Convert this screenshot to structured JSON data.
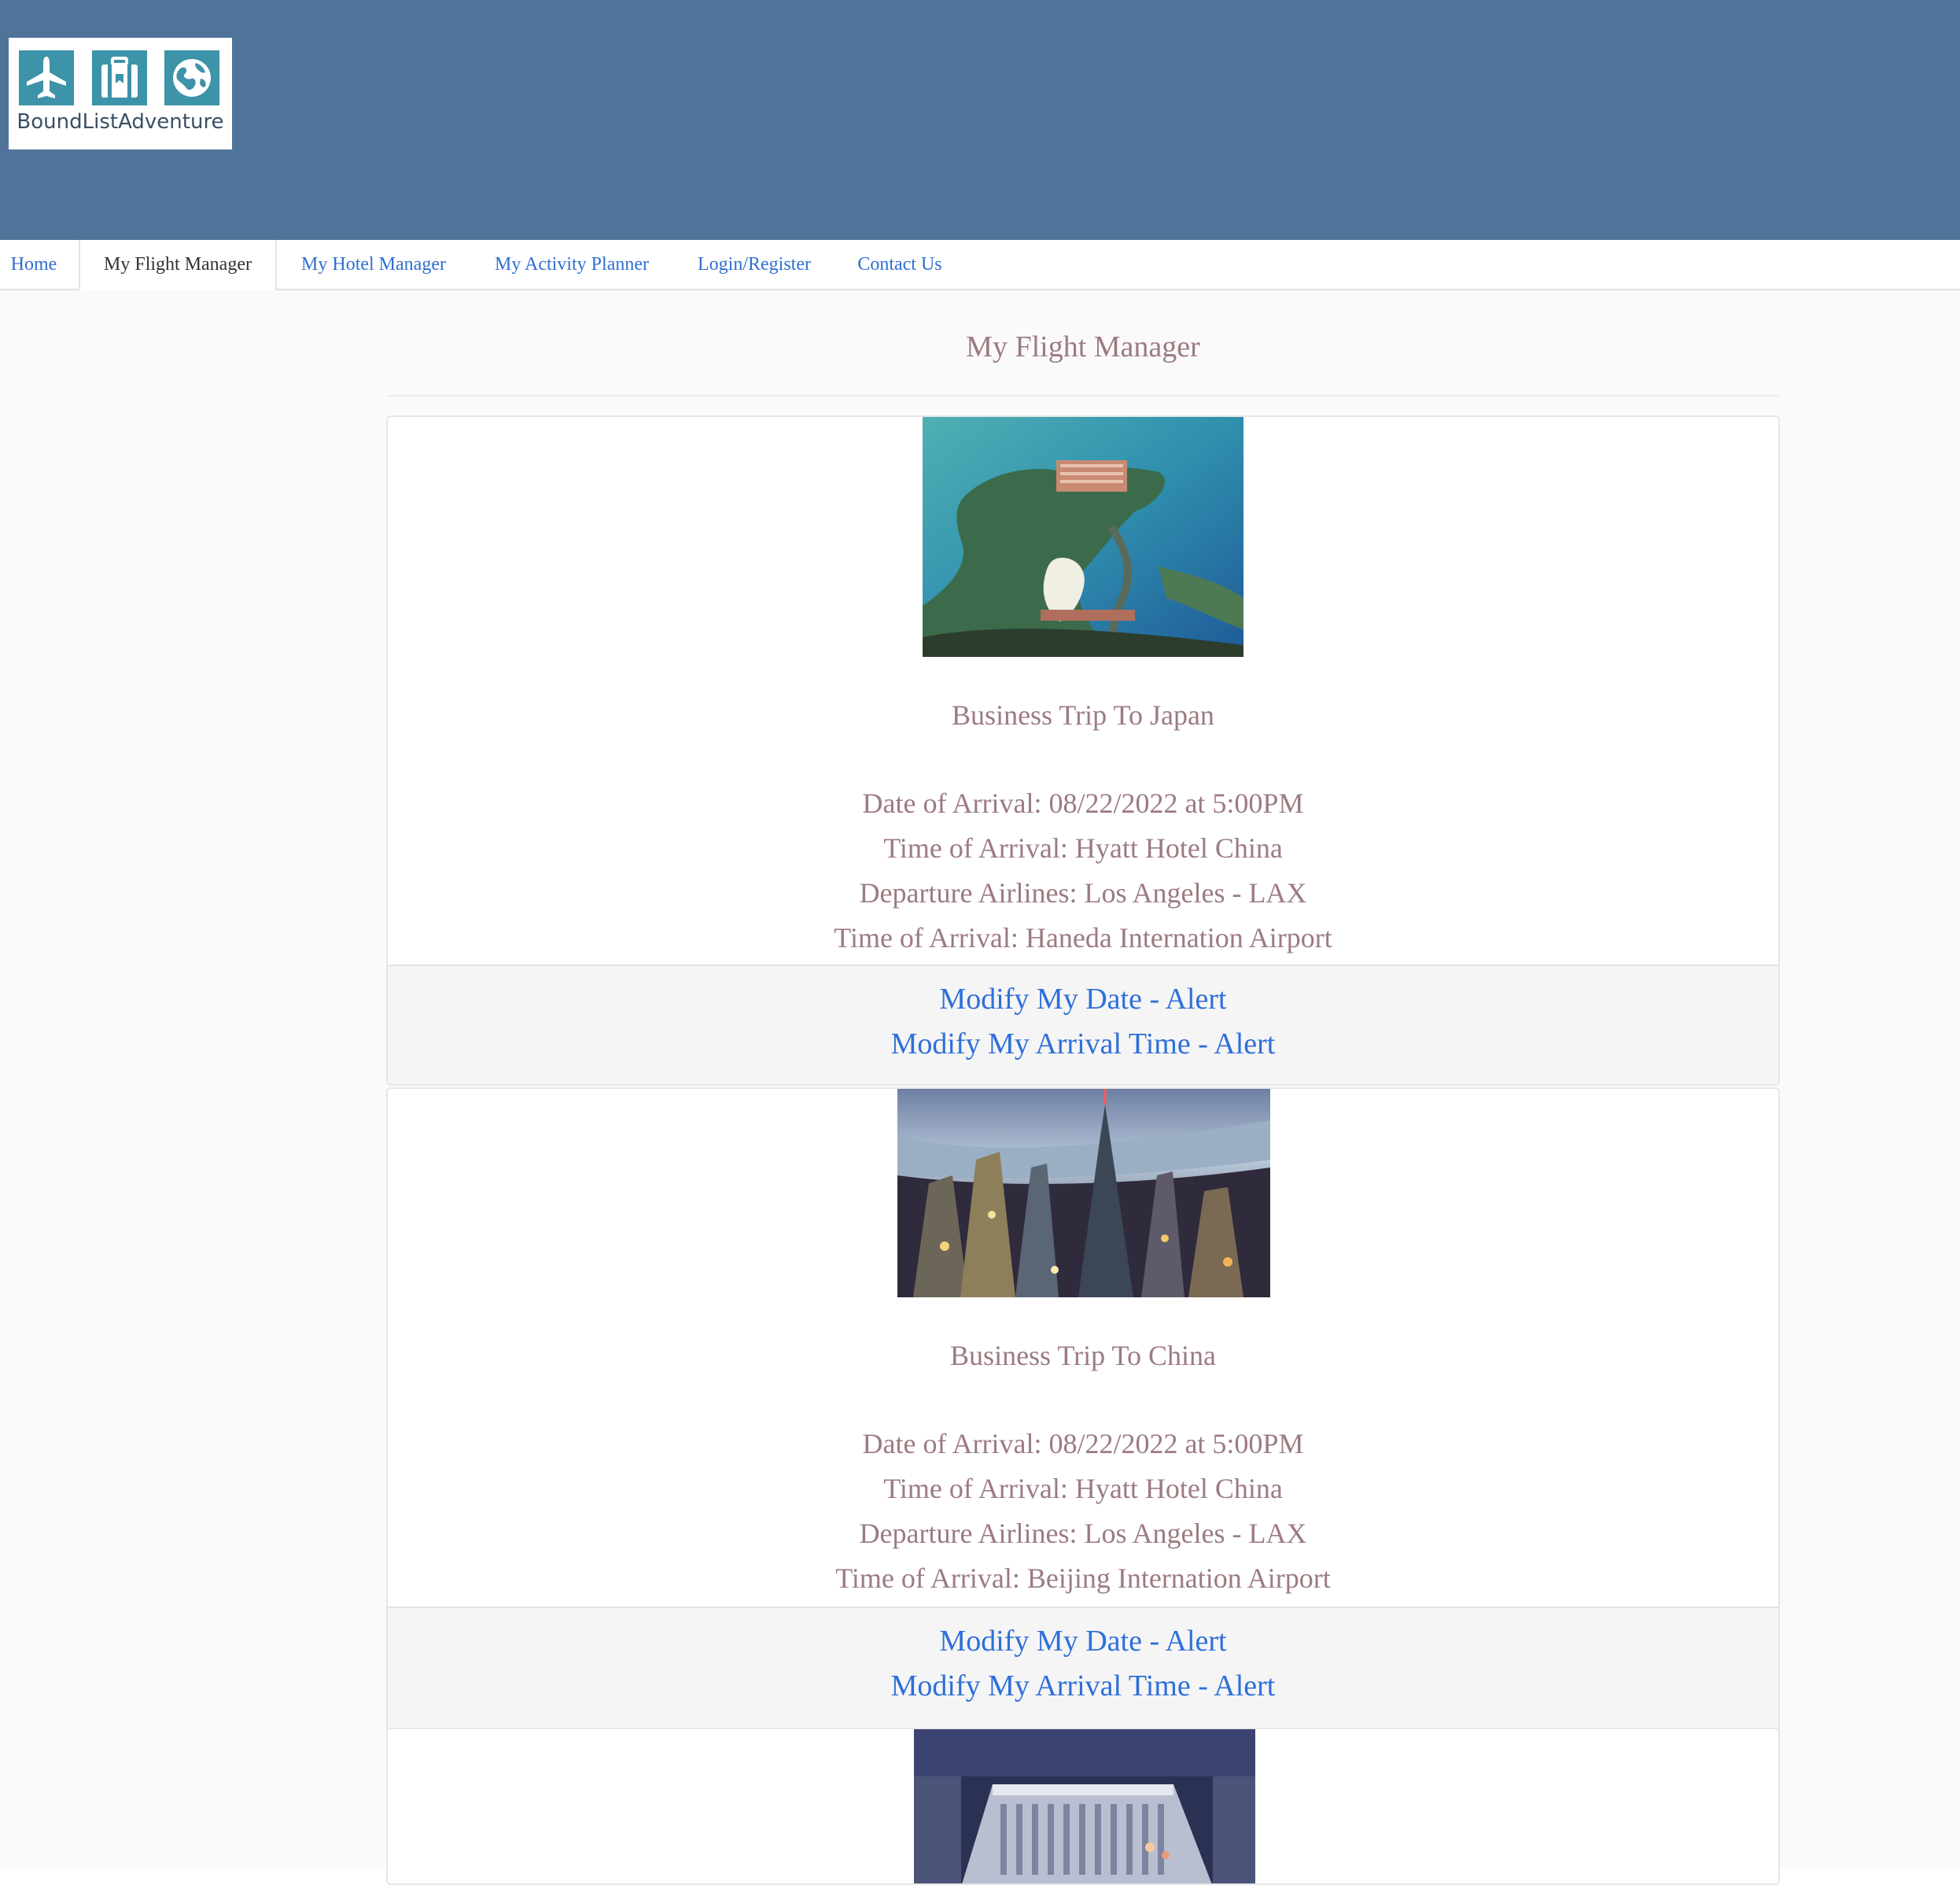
{
  "brand": {
    "logo_text": "BoundListAdventure",
    "header_color": "#507499",
    "logo_tile_color": "#3d93a8",
    "icons": [
      "airplane-icon",
      "luggage-icon",
      "globe-icon"
    ]
  },
  "nav": {
    "items": [
      {
        "label": "Home"
      },
      {
        "label": "My Flight Manager"
      },
      {
        "label": "My Hotel Manager"
      },
      {
        "label": "My Activity Planner"
      },
      {
        "label": "Login/Register"
      },
      {
        "label": "Contact Us"
      }
    ],
    "active": "My Flight Manager",
    "link_color": "#2f6fd1"
  },
  "page": {
    "title": "My Flight Manager",
    "text_color": "#9c7b80"
  },
  "trips": [
    {
      "title": "Business Trip To Japan",
      "image": "japan-resort-image",
      "lines": [
        "Date of Arrival: 08/22/2022 at 5:00PM",
        "Time of Arrival: Hyatt Hotel China",
        "Departure Airlines: Los Angeles - LAX",
        "Time of Arrival: Haneda Internation Airport"
      ],
      "actions": [
        "Modify My Date - Alert",
        "Modify My Arrival Time - Alert"
      ]
    },
    {
      "title": "Business Trip To China",
      "image": "china-skyline-image",
      "lines": [
        "Date of Arrival: 08/22/2022 at 5:00PM",
        "Time of Arrival: Hyatt Hotel China",
        "Departure Airlines: Los Angeles - LAX",
        "Time of Arrival: Beijing Internation Airport"
      ],
      "actions": [
        "Modify My Date - Alert",
        "Modify My Arrival Time - Alert"
      ]
    },
    {
      "image": "city-building-image"
    }
  ]
}
